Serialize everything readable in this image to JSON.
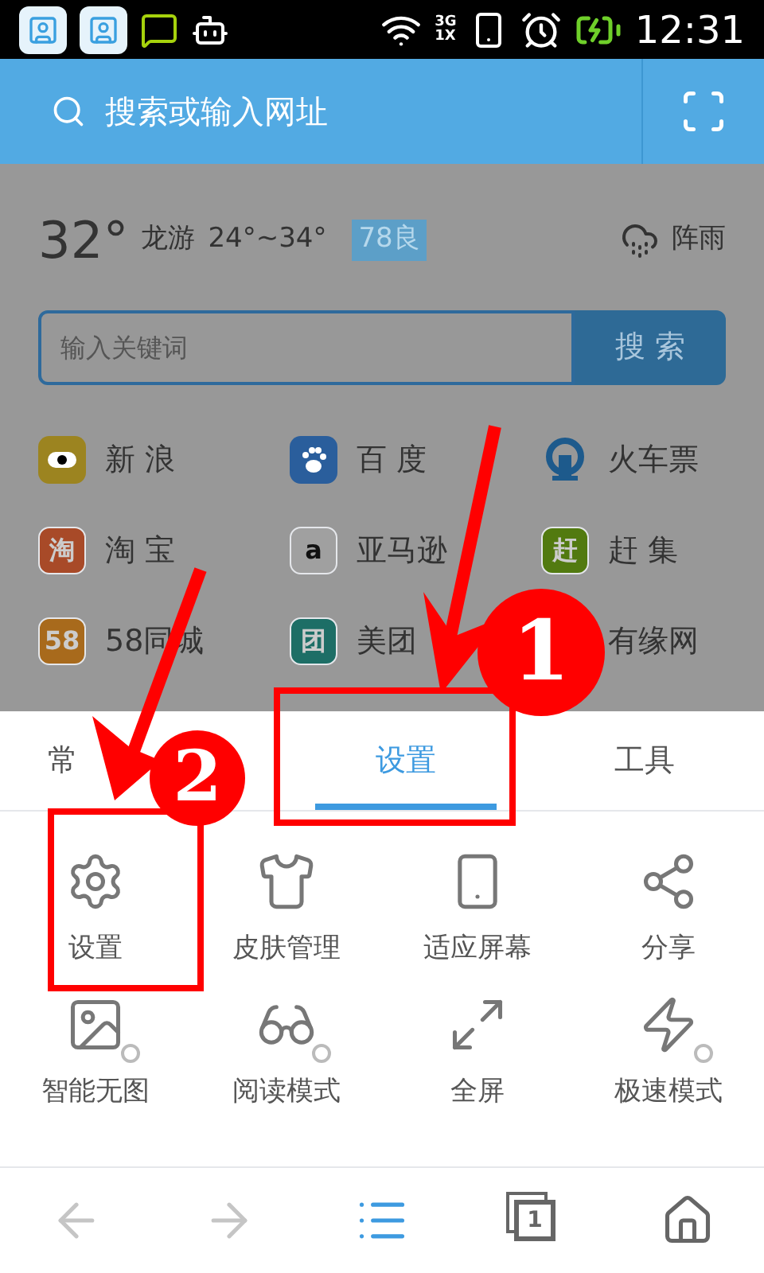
{
  "status_bar": {
    "network_labels": [
      "3G",
      "1X"
    ],
    "time": "12:31"
  },
  "address_bar": {
    "placeholder": "搜索或输入网址"
  },
  "weather": {
    "temperature": "32°",
    "city": "龙游",
    "range": "24°~34°",
    "air_quality": "78良",
    "condition": "阵雨"
  },
  "search": {
    "placeholder": "输入关键词",
    "button": "搜 索"
  },
  "shortcuts": [
    {
      "label": "新 浪",
      "kind": "eye",
      "color": "#9c8420"
    },
    {
      "label": "百 度",
      "kind": "paw",
      "color": "#2a5e9c"
    },
    {
      "label": "火车票",
      "kind": "rail",
      "color": "#1d5a8c"
    },
    {
      "label": "淘 宝",
      "kind": "glyph",
      "glyph": "淘",
      "color": "#a84a28"
    },
    {
      "label": "亚马逊",
      "kind": "glyph",
      "glyph": "a",
      "color": "#a0a0a0"
    },
    {
      "label": "赶 集",
      "kind": "glyph",
      "glyph": "赶",
      "color": "#527a10"
    },
    {
      "label": "58同城",
      "kind": "glyph",
      "glyph": "58",
      "color": "#a86a1c"
    },
    {
      "label": "美团",
      "kind": "glyph",
      "glyph": "团",
      "color": "#1d6e66"
    },
    {
      "label": "有缘网",
      "kind": "hidden"
    }
  ],
  "menu": {
    "tabs": [
      {
        "label": "常",
        "selected": false
      },
      {
        "label": "设置",
        "selected": true
      },
      {
        "label": "工具",
        "selected": false
      }
    ],
    "items": [
      {
        "label": "设置",
        "kind": "gear"
      },
      {
        "label": "皮肤管理",
        "kind": "shirt"
      },
      {
        "label": "适应屏幕",
        "kind": "fit"
      },
      {
        "label": "分享",
        "kind": "share"
      },
      {
        "label": "智能无图",
        "kind": "image",
        "on": false
      },
      {
        "label": "阅读模式",
        "kind": "glasses",
        "on": false
      },
      {
        "label": "全屏",
        "kind": "fullscreen"
      },
      {
        "label": "极速模式",
        "kind": "bolt",
        "on": false
      }
    ]
  },
  "bottom_nav": {
    "items": [
      {
        "kind": "back",
        "disabled": true,
        "selected": false
      },
      {
        "kind": "forward",
        "disabled": true,
        "selected": false
      },
      {
        "kind": "menu",
        "disabled": false,
        "selected": true
      },
      {
        "kind": "tabs",
        "disabled": false,
        "selected": false,
        "count": "1"
      },
      {
        "kind": "home",
        "disabled": false,
        "selected": false
      }
    ]
  },
  "annotations": [
    {
      "number": "1"
    },
    {
      "number": "2"
    }
  ]
}
